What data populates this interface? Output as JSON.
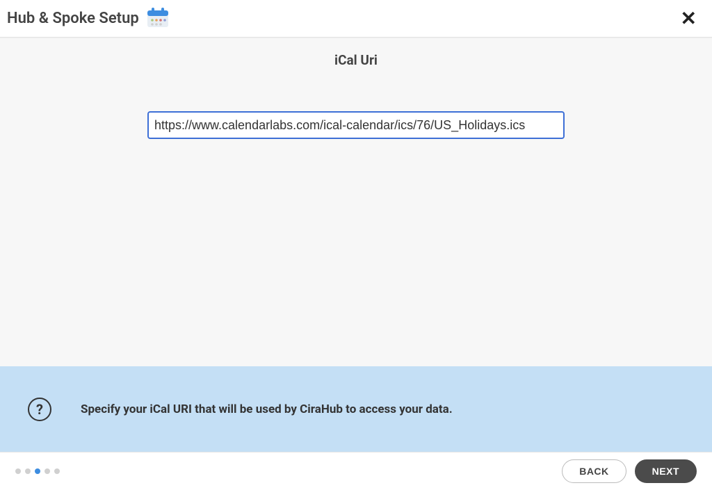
{
  "header": {
    "title": "Hub & Spoke Setup"
  },
  "section": {
    "title": "iCal Uri"
  },
  "input": {
    "value": "https://www.calendarlabs.com/ical-calendar/ics/76/US_Holidays.ics"
  },
  "help": {
    "text": "Specify your iCal URI that will be used by CiraHub to access your data."
  },
  "footer": {
    "total_steps": 5,
    "active_step_index": 2,
    "back_label": "BACK",
    "next_label": "NEXT"
  }
}
